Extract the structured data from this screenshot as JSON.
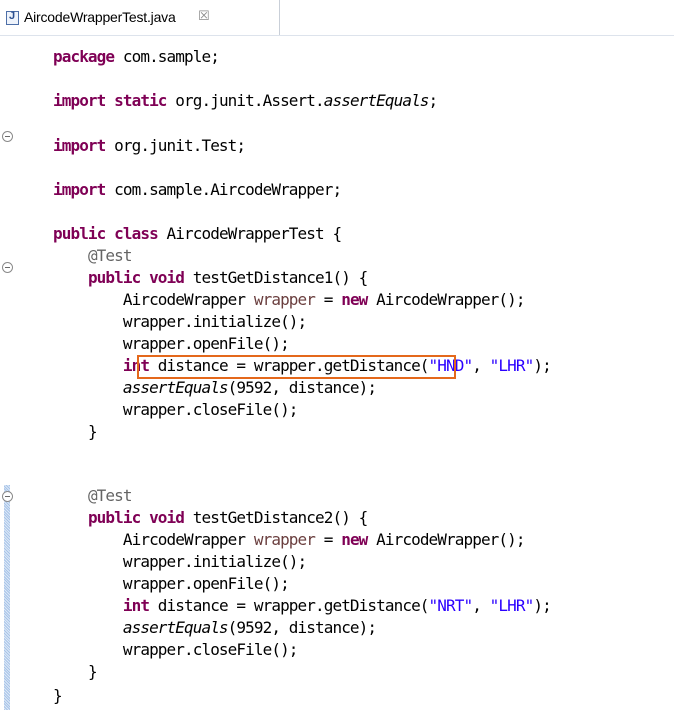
{
  "editor_tab": {
    "title": "AircodeWrapperTest.java",
    "icon": "java-file-icon",
    "close_glyph": "☒"
  },
  "code": {
    "package_kw": "package",
    "package_rest": " com.sample;",
    "import_kw": "import",
    "static_kw": "static",
    "import1_rest": " org.junit.Assert.",
    "import1_method": "assertEquals",
    "import1_end": ";",
    "import2_rest": " org.junit.Test;",
    "import3_rest": " com.sample.AircodeWrapper;",
    "public_kw": "public",
    "class_kw": "class",
    "class_decl": " AircodeWrapperTest {",
    "annotation": "@Test",
    "void_kw": "void",
    "method1_decl": " testGetDistance1() {",
    "method2_decl": " testGetDistance2() {",
    "type_name": "AircodeWrapper",
    "wrapper_var": "wrapper",
    "eq": " = ",
    "new_kw": "new",
    "ctor_call": " AircodeWrapper();",
    "init_call": "wrapper.initialize();",
    "open_call": "wrapper.openFile();",
    "int_kw": "int",
    "distance_decl": " distance = wrapper.getDistance(",
    "str_hnd": "\"HND\"",
    "str_nrt": "\"NRT\"",
    "comma": ", ",
    "str_lhr": "\"LHR\"",
    "close_paren": ");",
    "assert_method": "assertEquals",
    "assert_args": "(9592, distance);",
    "close_call": "wrapper.closeFile();",
    "close_brace": "}"
  }
}
